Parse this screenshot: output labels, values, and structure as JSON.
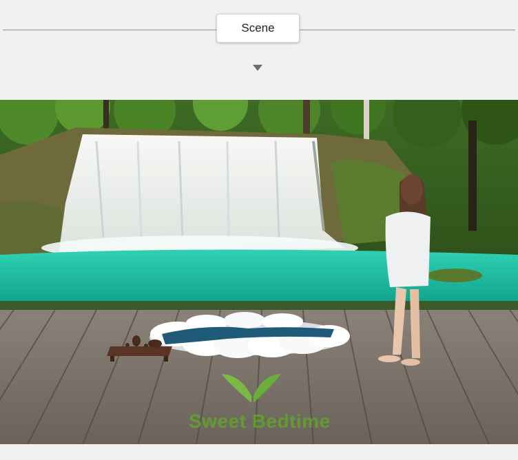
{
  "scene_selector": {
    "label": "Scene",
    "caret_icon": "triangle-down-icon"
  },
  "photo": {
    "watermark": "Sweet Bedtime",
    "logo_icon": "leaves-icon"
  },
  "colors": {
    "panel_bg": "#f1f1f1",
    "water": "#19b79c",
    "deck": "#7a7167",
    "foliage": "#2f5f1e",
    "watermark": "#5ea62a"
  }
}
